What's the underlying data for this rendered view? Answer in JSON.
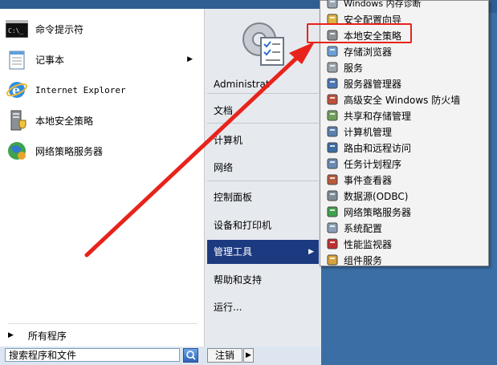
{
  "pinned": [
    {
      "label": "命令提示符",
      "icon": "cmd-icon",
      "has_arrow": false
    },
    {
      "label": "记事本",
      "icon": "notepad-icon",
      "has_arrow": true
    },
    {
      "label": "Internet Explorer",
      "icon": "ie-icon",
      "has_arrow": false
    },
    {
      "label": "本地安全策略",
      "icon": "local-security-policy-icon",
      "has_arrow": false
    },
    {
      "label": "网络策略服务器",
      "icon": "network-policy-server-icon",
      "has_arrow": false
    }
  ],
  "all_programs": "所有程序",
  "search": {
    "placeholder": "搜索程序和文件",
    "value": "搜索程序和文件"
  },
  "logoff": "注销",
  "right_pane": {
    "user": "Administrat",
    "items": [
      "文档",
      "计算机",
      "网络",
      "控制面板",
      "设备和打印机",
      "管理工具",
      "帮助和支持",
      "运行..."
    ],
    "selected": "管理工具"
  },
  "submenu": {
    "items": [
      "Windows 内存诊断",
      "安全配置向导",
      "本地安全策略",
      "存储浏览器",
      "服务",
      "服务器管理器",
      "高级安全 Windows 防火墙",
      "共享和存储管理",
      "计算机管理",
      "路由和远程访问",
      "任务计划程序",
      "事件查看器",
      "数据源(ODBC)",
      "网络策略服务器",
      "系统配置",
      "性能监视器",
      "组件服务"
    ],
    "highlighted": "本地安全策略"
  },
  "colors": {
    "annotation": "#e8231b",
    "selection": "#1c3a80",
    "desktop": "#3a6ea5"
  }
}
